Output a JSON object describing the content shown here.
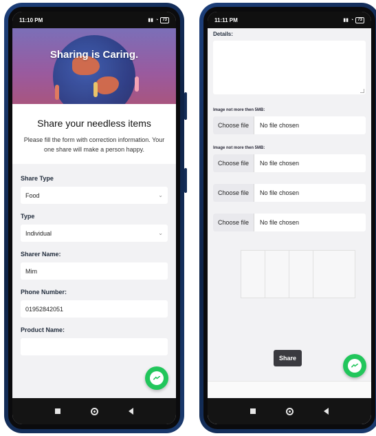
{
  "left": {
    "status": {
      "time": "11:10 PM",
      "battery": "73"
    },
    "hero": {
      "title": "Sharing is Caring."
    },
    "intro": {
      "heading": "Share your needless items",
      "description": "Please fill the form with correction information. Your one share will make a person happy."
    },
    "form": {
      "share_type": {
        "label": "Share Type",
        "value": "Food"
      },
      "type": {
        "label": "Type",
        "value": "Individual"
      },
      "sharer_name": {
        "label": "Sharer Name:",
        "value": "Mim"
      },
      "phone_number": {
        "label": "Phone Number:",
        "value": "01952842051"
      },
      "product_name": {
        "label": "Product Name:",
        "value": ""
      }
    }
  },
  "right": {
    "status": {
      "time": "11:11 PM",
      "battery": "73"
    },
    "details_label": "Details:",
    "image_label_1": "Image not more then 5MB:",
    "image_label_2": "Image not more then 5MB:",
    "file_inputs": [
      {
        "button": "Choose file",
        "text": "No file chosen"
      },
      {
        "button": "Choose file",
        "text": "No file chosen"
      },
      {
        "button": "Choose file",
        "text": "No file chosen"
      },
      {
        "button": "Choose file",
        "text": "No file chosen"
      }
    ],
    "share_button": "Share"
  },
  "colors": {
    "messenger": "#21c65b",
    "hero_top": "#7b6fb8",
    "hero_bottom": "#a8557f",
    "share_button": "#3a3a3f"
  },
  "icons": [
    "messenger-icon",
    "chevron-down-icon",
    "nav-square-icon",
    "nav-home-icon",
    "nav-back-icon",
    "wifi-icon",
    "signal-icon",
    "battery-icon"
  ]
}
